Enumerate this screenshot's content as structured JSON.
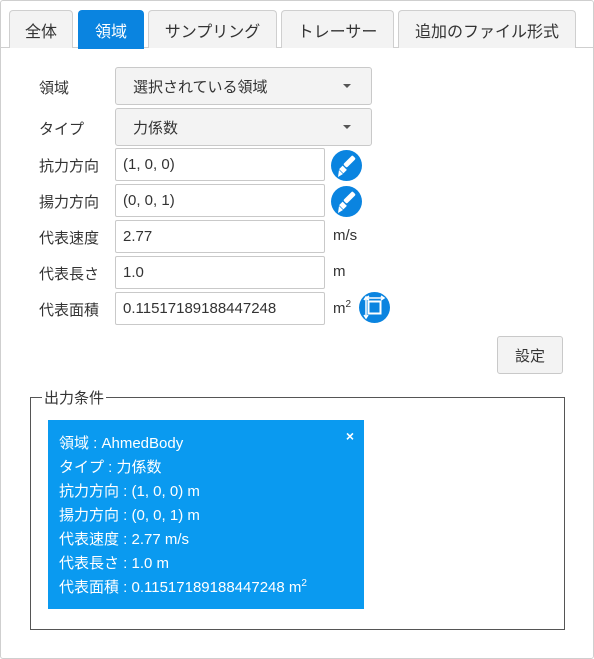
{
  "tabs": [
    {
      "label": "全体"
    },
    {
      "label": "領域"
    },
    {
      "label": "サンプリング"
    },
    {
      "label": "トレーサー"
    },
    {
      "label": "追加のファイル形式"
    }
  ],
  "active_tab": "領域",
  "form": {
    "region": {
      "label": "領域",
      "value": "選択されている領域"
    },
    "type": {
      "label": "タイプ",
      "value": "力係数"
    },
    "drag_direction": {
      "label": "抗力方向",
      "value": "(1, 0, 0)"
    },
    "lift_direction": {
      "label": "揚力方向",
      "value": "(0, 0, 1)"
    },
    "ref_velocity": {
      "label": "代表速度",
      "value": "2.77",
      "unit": "m/s"
    },
    "ref_length": {
      "label": "代表長さ",
      "value": "1.0",
      "unit": "m"
    },
    "ref_area": {
      "label": "代表面積",
      "value": "0.11517189188447248",
      "unit_base": "m",
      "unit_exp": "2"
    }
  },
  "set_button": "設定",
  "output": {
    "legend": "出力条件",
    "close_symbol": "×",
    "lines": [
      "領域 : AhmedBody",
      "タイプ : 力係数",
      "抗力方向 : (1, 0, 0) m",
      "揚力方向 : (0, 0, 1) m",
      "代表速度 : 2.77 m/s",
      "代表長さ : 1.0 m"
    ],
    "area_line": "代表面積 : 0.11517189188447248 m",
    "area_exp": "2"
  },
  "colors": {
    "accent": "#0a84e0",
    "card": "#0a9af0"
  },
  "icons": {
    "direction_picker": "paint-brush-icon",
    "area_calc": "resize-icon"
  }
}
